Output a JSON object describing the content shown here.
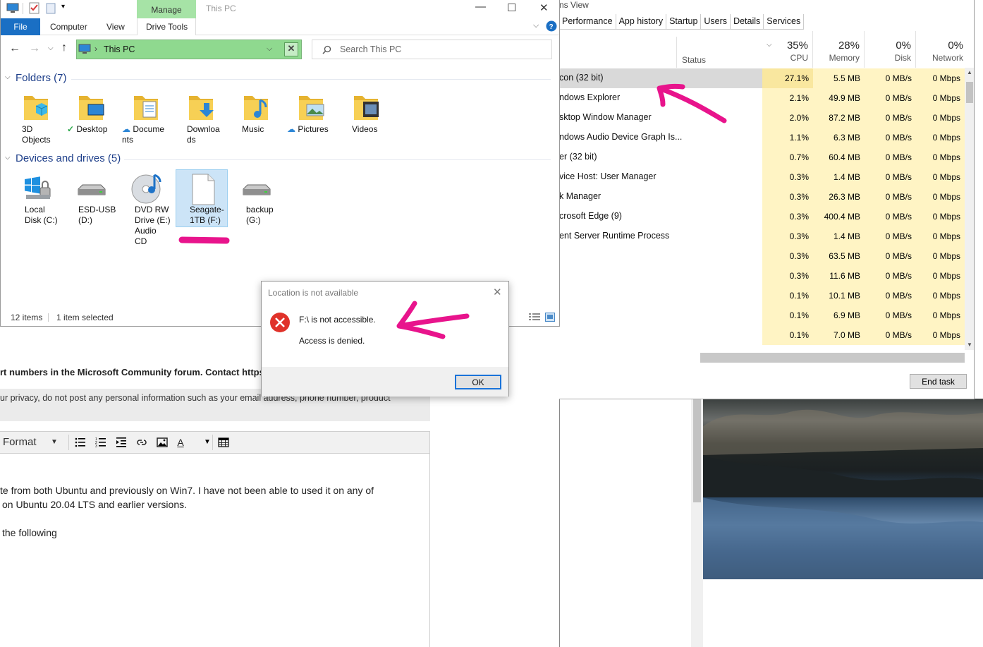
{
  "forum": {
    "bold_line": "rt numbers in the Microsoft Community forum. Contact https:/",
    "privacy_line": "ur privacy, do not post any personal information such as your email address, phone number, product",
    "toolbar_format": "Format",
    "body_lines": [
      "te from both Ubuntu and previously on Win7. I have not been able to used it on any of",
      "on Ubuntu 20.04 LTS and earlier versions.",
      "the following"
    ]
  },
  "task_manager": {
    "menu": "ns   View",
    "tabs": [
      "Performance",
      "App history",
      "Startup",
      "Users",
      "Details",
      "Services"
    ],
    "status_label": "Status",
    "columns": [
      {
        "pct": "35%",
        "label": "CPU"
      },
      {
        "pct": "28%",
        "label": "Memory"
      },
      {
        "pct": "0%",
        "label": "Disk"
      },
      {
        "pct": "0%",
        "label": "Network"
      }
    ],
    "rows": [
      {
        "name": "con (32 bit)",
        "cpu": "27.1%",
        "mem": "5.5 MB",
        "disk": "0 MB/s",
        "net": "0 Mbps",
        "selected": true
      },
      {
        "name": "ndows Explorer",
        "cpu": "2.1%",
        "mem": "49.9 MB",
        "disk": "0 MB/s",
        "net": "0 Mbps"
      },
      {
        "name": "sktop Window Manager",
        "cpu": "2.0%",
        "mem": "87.2 MB",
        "disk": "0 MB/s",
        "net": "0 Mbps"
      },
      {
        "name": "ndows Audio Device Graph Is...",
        "cpu": "1.1%",
        "mem": "6.3 MB",
        "disk": "0 MB/s",
        "net": "0 Mbps"
      },
      {
        "name": "er (32 bit)",
        "cpu": "0.7%",
        "mem": "60.4 MB",
        "disk": "0 MB/s",
        "net": "0 Mbps"
      },
      {
        "name": "vice Host: User Manager",
        "cpu": "0.3%",
        "mem": "1.4 MB",
        "disk": "0 MB/s",
        "net": "0 Mbps"
      },
      {
        "name": "k Manager",
        "cpu": "0.3%",
        "mem": "26.3 MB",
        "disk": "0 MB/s",
        "net": "0 Mbps"
      },
      {
        "name": "crosoft Edge (9)",
        "cpu": "0.3%",
        "mem": "400.4 MB",
        "disk": "0 MB/s",
        "net": "0 Mbps"
      },
      {
        "name": "ent Server Runtime Process",
        "cpu": "0.3%",
        "mem": "1.4 MB",
        "disk": "0 MB/s",
        "net": "0 Mbps"
      },
      {
        "name": "",
        "cpu": "0.3%",
        "mem": "63.5 MB",
        "disk": "0 MB/s",
        "net": "0 Mbps"
      },
      {
        "name": "",
        "cpu": "0.3%",
        "mem": "11.6 MB",
        "disk": "0 MB/s",
        "net": "0 Mbps"
      },
      {
        "name": "",
        "cpu": "0.1%",
        "mem": "10.1 MB",
        "disk": "0 MB/s",
        "net": "0 Mbps"
      },
      {
        "name": "",
        "cpu": "0.1%",
        "mem": "6.9 MB",
        "disk": "0 MB/s",
        "net": "0 Mbps"
      },
      {
        "name": "",
        "cpu": "0.1%",
        "mem": "7.0 MB",
        "disk": "0 MB/s",
        "net": "0 Mbps"
      }
    ],
    "end_task": "End task"
  },
  "explorer": {
    "title": "This PC",
    "manage_tab": "Manage",
    "drive_tools_tab": "Drive Tools",
    "file_tab": "File",
    "computer_tab": "Computer",
    "view_tab": "View",
    "address": "This PC",
    "search_placeholder": "Search This PC",
    "folders_header": "Folders (7)",
    "devices_header": "Devices and drives (5)",
    "folders": [
      "3D\nObjects",
      "Desktop",
      "Docume\nnts",
      "Downloa\nds",
      "Music",
      "Pictures",
      "Videos"
    ],
    "drives": [
      "Local\nDisk (C:)",
      "ESD-USB\n(D:)",
      "DVD RW\nDrive (E:)\nAudio\nCD",
      "Seagate-\n1TB (F:)",
      "backup\n(G:)"
    ],
    "status_items": "12 items",
    "status_selected": "1 item selected"
  },
  "dialog": {
    "title": "Location is not available",
    "message1": "F:\\ is not accessible.",
    "message2": "Access is denied.",
    "ok": "OK"
  },
  "colors": {
    "annotation": "#e8148c",
    "selection": "#cce4f7",
    "address_highlight": "#8fd98f"
  }
}
